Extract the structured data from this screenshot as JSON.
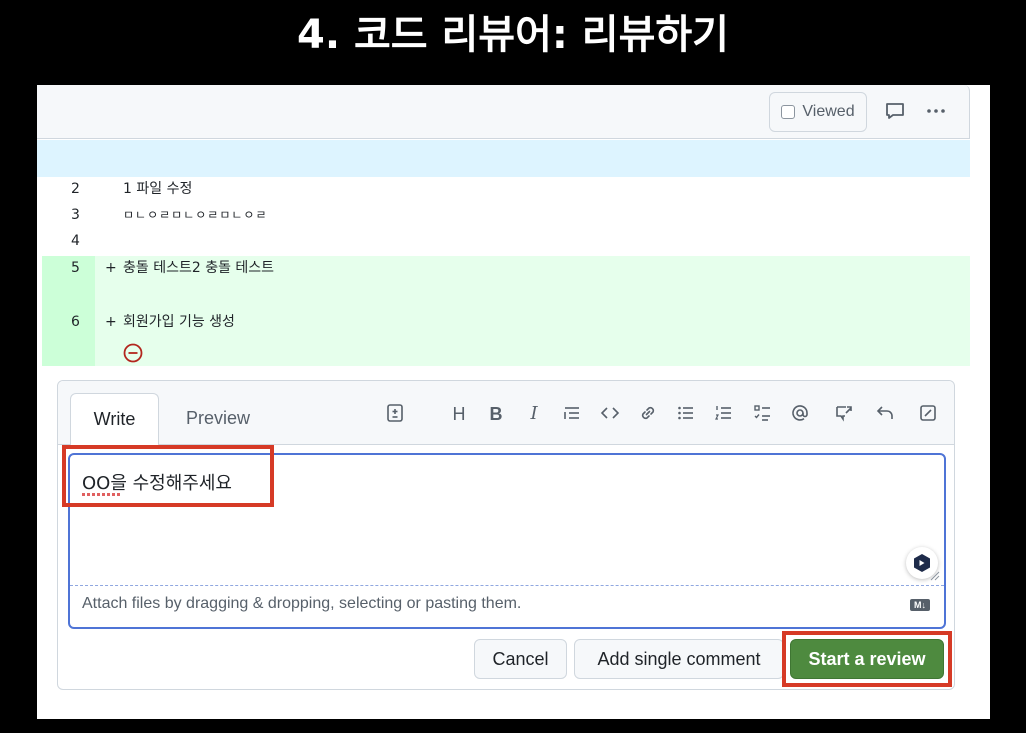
{
  "slide": {
    "title": "4. 코드 리뷰어: 리뷰하기"
  },
  "file_header": {
    "viewed_label": "Viewed",
    "icons": [
      "comment-icon",
      "kebab-icon"
    ]
  },
  "diff": {
    "lines": [
      {
        "number": "2",
        "marker": "",
        "code": "1 파일 수정",
        "type": "context"
      },
      {
        "number": "3",
        "marker": "",
        "code": "ㅁㄴㅇㄹㅁㄴㅇㄹㅁㄴㅇㄹ",
        "type": "context"
      },
      {
        "number": "4",
        "marker": "",
        "code": "",
        "type": "context"
      },
      {
        "number": "5",
        "marker": "+",
        "code": "충돌 테스트2 충돌 테스트",
        "type": "added"
      },
      {
        "number": "6",
        "marker": "+",
        "code": "회원가입 기능 생성",
        "type": "added"
      }
    ]
  },
  "comment": {
    "tabs": {
      "write": "Write",
      "preview": "Preview"
    },
    "toolbar_icons": [
      "add-suggestion-icon",
      "heading-icon",
      "bold-icon",
      "italic-icon",
      "quote-icon",
      "code-icon",
      "link-icon",
      "bulleted-list-icon",
      "numbered-list-icon",
      "task-list-icon",
      "mention-icon",
      "reference-icon",
      "reply-icon",
      "fullscreen-icon"
    ],
    "text": "OO을 수정해주세요",
    "attach_hint": "Attach files by dragging & dropping, selecting or pasting them.",
    "markdown_badge": "M↓",
    "buttons": {
      "cancel": "Cancel",
      "single": "Add single comment",
      "review": "Start a review"
    }
  },
  "colors": {
    "highlight": "#d63a26",
    "primary": "#4e8a3f",
    "added_bg": "#e6ffec",
    "hunk_bg": "#ddf4ff"
  }
}
